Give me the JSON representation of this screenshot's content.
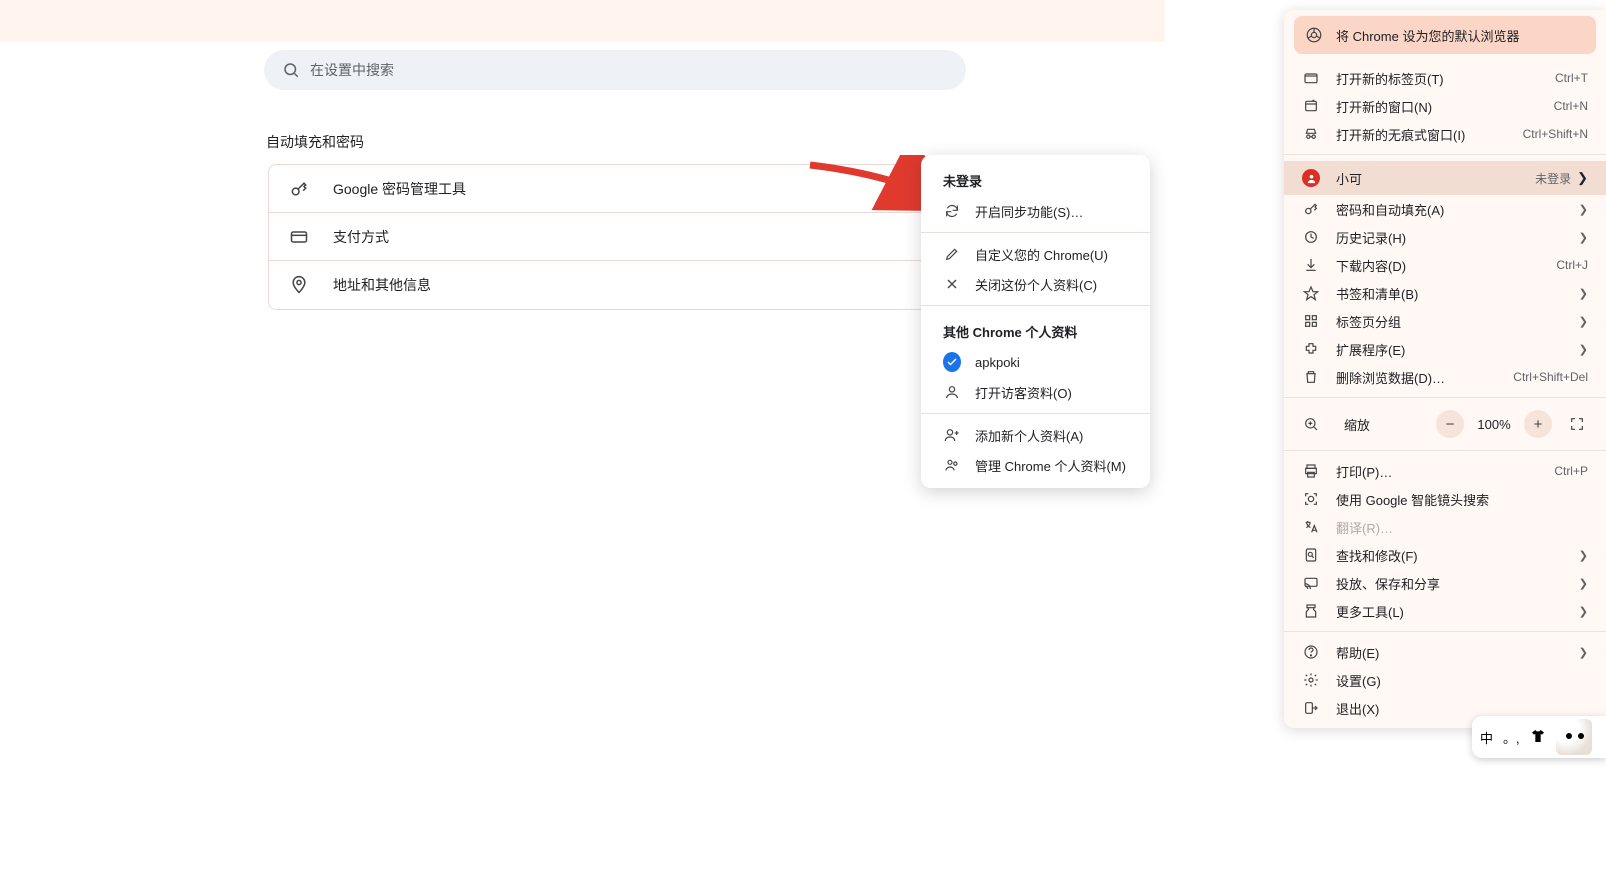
{
  "search": {
    "placeholder": "在设置中搜索"
  },
  "section_title": "自动填充和密码",
  "card": {
    "password_manager": "Google 密码管理工具",
    "payment": "支付方式",
    "addresses": "地址和其他信息"
  },
  "profile_menu": {
    "header": "未登录",
    "enable_sync": "开启同步功能(S)…",
    "customize": "自定义您的 Chrome(U)",
    "close_profile": "关闭这份个人资料(C)",
    "other_profiles_header": "其他 Chrome 个人资料",
    "profile1": "apkpoki",
    "guest": "打开访客资料(O)",
    "add_profile": "添加新个人资料(A)",
    "manage_profiles": "管理 Chrome 个人资料(M)"
  },
  "main_menu": {
    "banner": "将 Chrome 设为您的默认浏览器",
    "new_tab": {
      "label": "打开新的标签页(T)",
      "shortcut": "Ctrl+T"
    },
    "new_window": {
      "label": "打开新的窗口(N)",
      "shortcut": "Ctrl+N"
    },
    "incognito": {
      "label": "打开新的无痕式窗口(I)",
      "shortcut": "Ctrl+Shift+N"
    },
    "profile": {
      "name": "小可",
      "status": "未登录"
    },
    "passwords_autofill": "密码和自动填充(A)",
    "history": "历史记录(H)",
    "downloads": {
      "label": "下载内容(D)",
      "shortcut": "Ctrl+J"
    },
    "bookmarks": "书签和清单(B)",
    "tab_groups": "标签页分组",
    "extensions": "扩展程序(E)",
    "clear_data": {
      "label": "删除浏览数据(D)…",
      "shortcut": "Ctrl+Shift+Del"
    },
    "zoom": {
      "label": "缩放",
      "value": "100%"
    },
    "print": {
      "label": "打印(P)…",
      "shortcut": "Ctrl+P"
    },
    "lens": "使用 Google 智能镜头搜索",
    "translate": "翻译(R)…",
    "find": "查找和修改(F)",
    "cast": "投放、保存和分享",
    "more_tools": "更多工具(L)",
    "help": "帮助(E)",
    "settings": "设置(G)",
    "exit": "退出(X)"
  },
  "ime": {
    "lang": "中",
    "punct": "。,"
  }
}
